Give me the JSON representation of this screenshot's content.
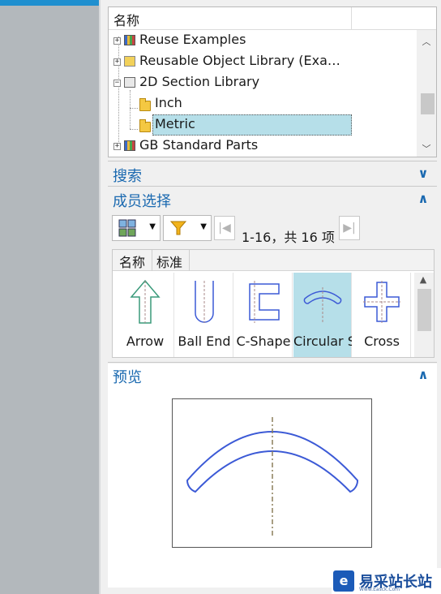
{
  "tree": {
    "header": "名称",
    "rows": [
      {
        "label": "Reuse Examples",
        "expander": "+",
        "icon": "reuse-icon"
      },
      {
        "label": "Reusable Object Library (Exa…",
        "expander": "+",
        "icon": "reuse-library-icon"
      },
      {
        "label": "2D Section Library",
        "expander": "−",
        "icon": "section-library-icon"
      },
      {
        "label": "Inch",
        "icon": "folder-icon"
      },
      {
        "label": "Metric",
        "icon": "folder-icon",
        "selected": true
      },
      {
        "label": "GB Standard Parts",
        "expander": "+",
        "icon": "library-books-icon"
      }
    ]
  },
  "search_section": {
    "title": "搜索",
    "chevron": "∨"
  },
  "member_section": {
    "title": "成员选择",
    "chevron": "∧",
    "page_info": "1-16，共 16 项",
    "tabs": [
      "名称",
      "标准"
    ],
    "cards": [
      {
        "name": "Arrow"
      },
      {
        "name": "Ball End"
      },
      {
        "name": "C-Shape"
      },
      {
        "name": "Circular Slot",
        "selected": true
      },
      {
        "name": "Cross"
      }
    ]
  },
  "preview_section": {
    "title": "预览",
    "chevron": "∧"
  },
  "watermark": {
    "text": "易采站长站",
    "sub": "Www.Easck.Com"
  },
  "colors": {
    "accent": "#1a69b0",
    "selection": "#b6dfe9",
    "shape_stroke": "#3c5ad6"
  }
}
